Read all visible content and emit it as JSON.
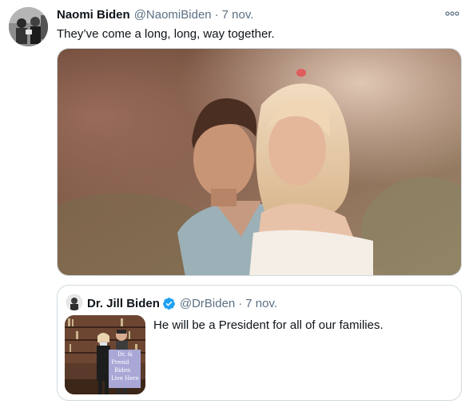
{
  "tweet": {
    "author_name": "Naomi Biden",
    "author_handle": "@NaomiBiden",
    "separator": "·",
    "timestamp": "7 nov.",
    "text": "They’ve come a long, long, way together.",
    "icons": {
      "avatar": "profile-photo",
      "more": "more-options-icon",
      "media": "photo"
    }
  },
  "quoted_tweet": {
    "author_name": "Dr. Jill Biden",
    "author_handle": "@DrBiden",
    "separator": "·",
    "timestamp": "7 nov.",
    "text": "He will be a President for all of our families.",
    "verified": true,
    "sign_text": [
      "Dr. &",
      "Presid",
      "Biden",
      "Live Here"
    ],
    "icons": {
      "verified": "verified-badge-icon",
      "avatar": "profile-photo",
      "media": "photo"
    }
  },
  "colors": {
    "text_primary": "#0f1419",
    "text_secondary": "#5b7083",
    "border": "#cfd9de",
    "verified_blue": "#1da1f2"
  }
}
